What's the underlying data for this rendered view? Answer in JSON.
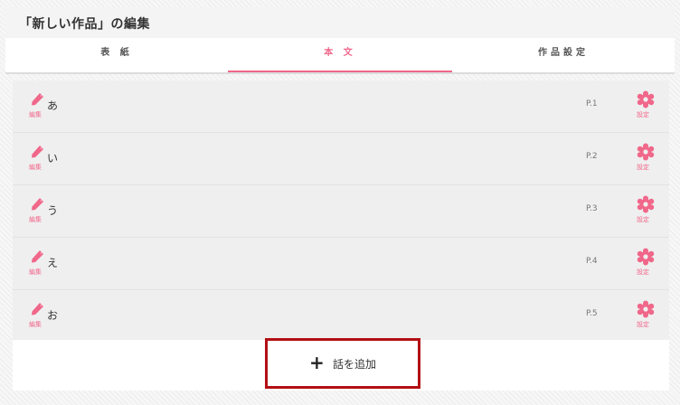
{
  "page": {
    "title": "「新しい作品」の編集"
  },
  "tabs": [
    {
      "label": "表 紙",
      "active": false
    },
    {
      "label": "本 文",
      "active": true
    },
    {
      "label": "作品設定",
      "active": false
    }
  ],
  "episodes": [
    {
      "title": "あ",
      "page": "P.1",
      "edit_label": "編集",
      "settings_label": "設定"
    },
    {
      "title": "い",
      "page": "P.2",
      "edit_label": "編集",
      "settings_label": "設定"
    },
    {
      "title": "う",
      "page": "P.3",
      "edit_label": "編集",
      "settings_label": "設定"
    },
    {
      "title": "え",
      "page": "P.4",
      "edit_label": "編集",
      "settings_label": "設定"
    },
    {
      "title": "お",
      "page": "P.5",
      "edit_label": "編集",
      "settings_label": "設定"
    }
  ],
  "add_button": {
    "icon": "+",
    "label": "話を追加"
  },
  "colors": {
    "accent": "#f0678a",
    "highlight_border": "#b30f14"
  },
  "icons": {
    "edit": "pencil-icon",
    "settings": "gear-icon",
    "add": "plus-icon"
  }
}
